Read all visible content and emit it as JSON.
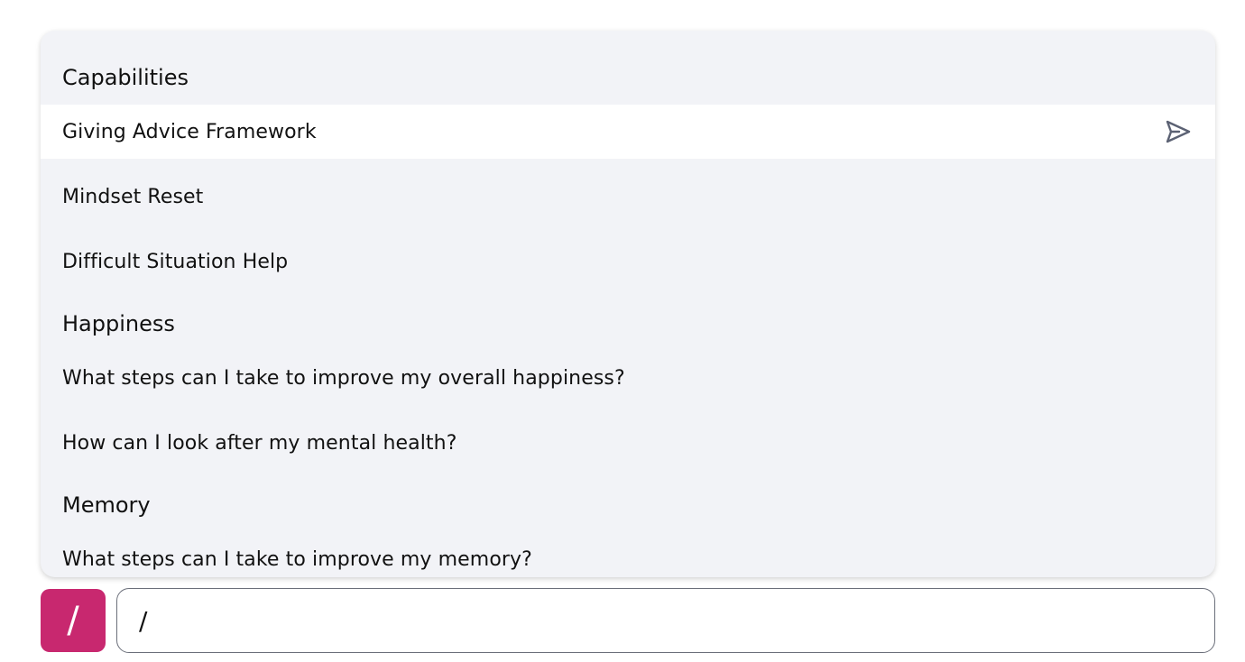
{
  "menu": {
    "sections": [
      {
        "title": "Capabilities",
        "items": [
          {
            "label": "Giving Advice Framework",
            "selected": true
          },
          {
            "label": "Mindset Reset",
            "selected": false
          },
          {
            "label": "Difficult Situation Help",
            "selected": false
          }
        ]
      },
      {
        "title": "Happiness",
        "items": [
          {
            "label": "What steps can I take to improve my overall happiness?",
            "selected": false
          },
          {
            "label": "How can I look after my mental health?",
            "selected": false
          }
        ]
      },
      {
        "title": "Memory",
        "items": [
          {
            "label": "What steps can I take to improve my memory?",
            "selected": false
          }
        ]
      }
    ],
    "selected_action_icon": "send-icon"
  },
  "composer": {
    "command_button_label": "/",
    "command_button_color": "#c8286f",
    "input_value": "/"
  },
  "colors": {
    "panel_background": "#f2f3f7",
    "selected_row_background": "#ffffff",
    "icon_color": "#5b6173"
  }
}
